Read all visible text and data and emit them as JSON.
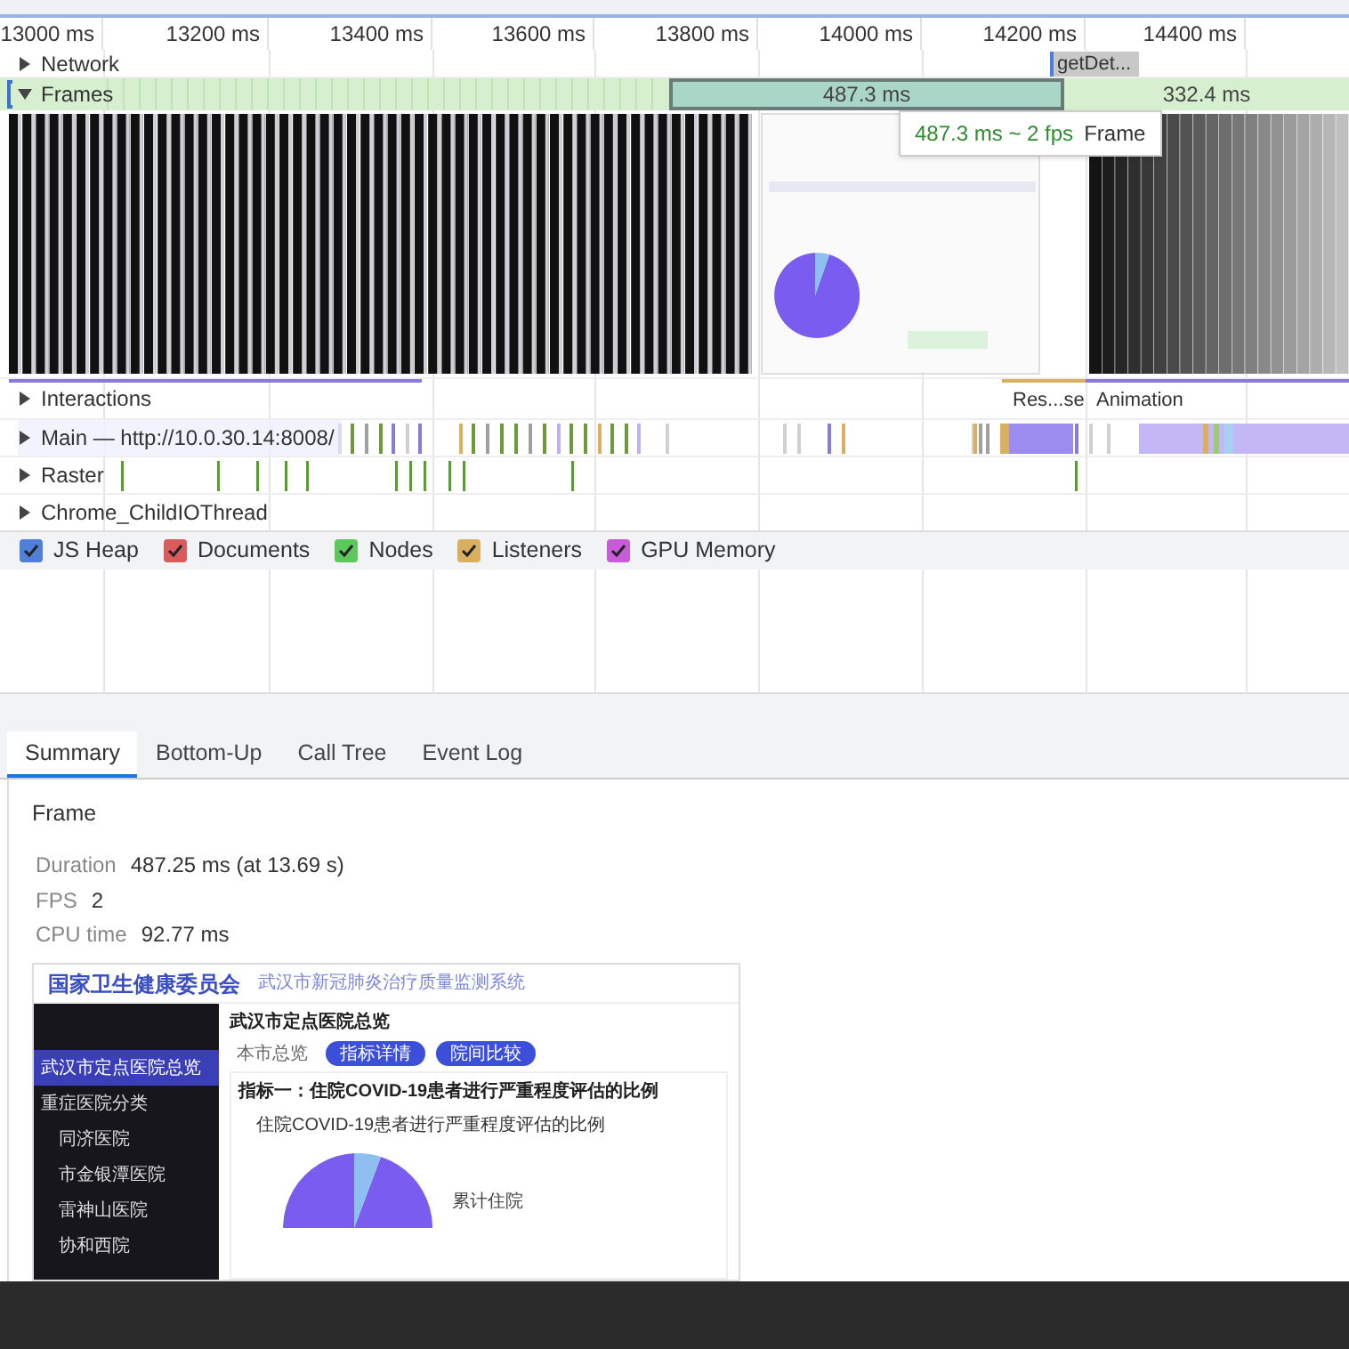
{
  "ruler": {
    "ticks": [
      "13000 ms",
      "13200 ms",
      "13400 ms",
      "13600 ms",
      "13800 ms",
      "14000 ms",
      "14200 ms",
      "14400 ms"
    ]
  },
  "tracks": [
    {
      "kind": "network",
      "label": "Network",
      "expanded": false,
      "event": "getDet..."
    },
    {
      "kind": "frames",
      "label": "Frames",
      "expanded": true,
      "frames": [
        {
          "label": "487.3 ms",
          "selected": true
        },
        {
          "label": "332.4 ms",
          "selected": false
        }
      ]
    },
    {
      "kind": "filmstrip"
    },
    {
      "kind": "interactions",
      "label": "Interactions",
      "expanded": false,
      "events": [
        "Res...se",
        "Animation"
      ]
    },
    {
      "kind": "main",
      "label": "Main — http://10.0.30.14:8008/",
      "expanded": false
    },
    {
      "kind": "raster",
      "label": "Raster",
      "expanded": false
    },
    {
      "kind": "thread",
      "label": "Chrome_ChildIOThread",
      "expanded": false
    }
  ],
  "tooltip": {
    "duration": "487.3 ms ~ 2 fps",
    "label": "Frame"
  },
  "memory_legend": [
    {
      "label": "JS Heap",
      "checked": true,
      "color": "#4f7fd8"
    },
    {
      "label": "Documents",
      "checked": true,
      "color": "#d85c5c"
    },
    {
      "label": "Nodes",
      "checked": true,
      "color": "#5cc85c"
    },
    {
      "label": "Listeners",
      "checked": true,
      "color": "#d8b060"
    },
    {
      "label": "GPU Memory",
      "checked": true,
      "color": "#c85cd8"
    }
  ],
  "tabs": [
    {
      "label": "Summary",
      "selected": true
    },
    {
      "label": "Bottom-Up",
      "selected": false
    },
    {
      "label": "Call Tree",
      "selected": false
    },
    {
      "label": "Event Log",
      "selected": false
    }
  ],
  "summary": {
    "title": "Frame",
    "fields": [
      {
        "label": "Duration",
        "value": "487.25 ms (at 13.69 s)"
      },
      {
        "label": "FPS",
        "value": "2"
      },
      {
        "label": "CPU time",
        "value": "92.77 ms"
      }
    ],
    "screenshot": {
      "org": "国家卫生健康委员会",
      "system": "武汉市新冠肺炎治疗质量监测系统",
      "page_title": "武汉市定点医院总览",
      "view_buttons": [
        {
          "label": "本市总览",
          "kind": "plain"
        },
        {
          "label": "指标详情",
          "kind": "filled"
        },
        {
          "label": "院间比较",
          "kind": "filled"
        }
      ],
      "sidebar": [
        {
          "label": "武汉市定点医院总览",
          "selected": true,
          "kind": "top"
        },
        {
          "label": "重症医院分类",
          "selected": false,
          "kind": "top"
        },
        {
          "label": "同济医院",
          "selected": false,
          "kind": "sub"
        },
        {
          "label": "市金银潭医院",
          "selected": false,
          "kind": "sub"
        },
        {
          "label": "雷神山医院",
          "selected": false,
          "kind": "sub"
        },
        {
          "label": "协和西院",
          "selected": false,
          "kind": "sub"
        }
      ],
      "indicator_title": "指标一：住院COVID-19患者进行严重程度评估的比例",
      "chart_title": "住院COVID-19患者进行严重程度评估的比例",
      "table_row": "累计住院"
    }
  }
}
